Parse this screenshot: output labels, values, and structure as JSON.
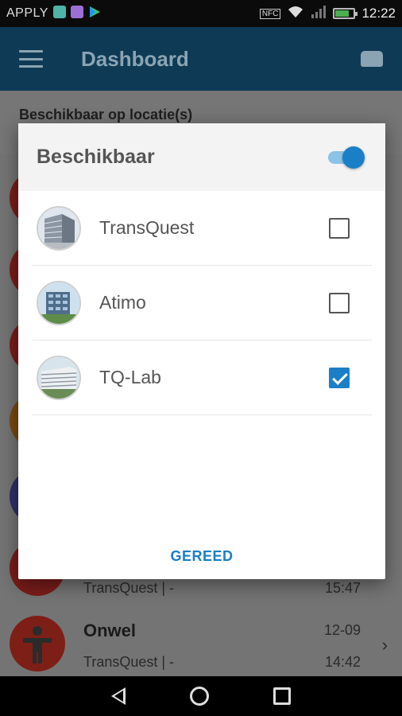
{
  "status_bar": {
    "carrier": "APPLY",
    "nfc": "NFC",
    "time": "12:22",
    "battery_level": 0.75,
    "icons": [
      "app-icon-teal",
      "app-icon-purple",
      "play-store-icon"
    ]
  },
  "app_bar": {
    "title": "Dashboard",
    "menu_icon": "hamburger-icon",
    "action_icon": "car-icon"
  },
  "background": {
    "header": "Beschikbaar op locatie(s)",
    "rows": [
      {
        "name": "",
        "sub": "TransQuest | -",
        "date": "",
        "time": "15:47",
        "avatar_color": "#7a1d1a"
      },
      {
        "name": "Onwel",
        "sub": "TransQuest | -",
        "date": "12-09",
        "time": "14:42",
        "avatar_color": "#7d1f17"
      }
    ],
    "avatar_colors": [
      "#7a1d1a",
      "#7a1d1a",
      "#7a1d1a",
      "#7a4a10",
      "#30306a"
    ]
  },
  "dialog": {
    "title": "Beschikbaar",
    "toggle_on": true,
    "locations": [
      {
        "name": "TransQuest",
        "checked": false
      },
      {
        "name": "Atimo",
        "checked": false
      },
      {
        "name": "TQ-Lab",
        "checked": true
      }
    ],
    "action_label": "GEREED"
  },
  "colors": {
    "accent": "#1a7fc6",
    "app_bar": "#0f5f8f"
  }
}
